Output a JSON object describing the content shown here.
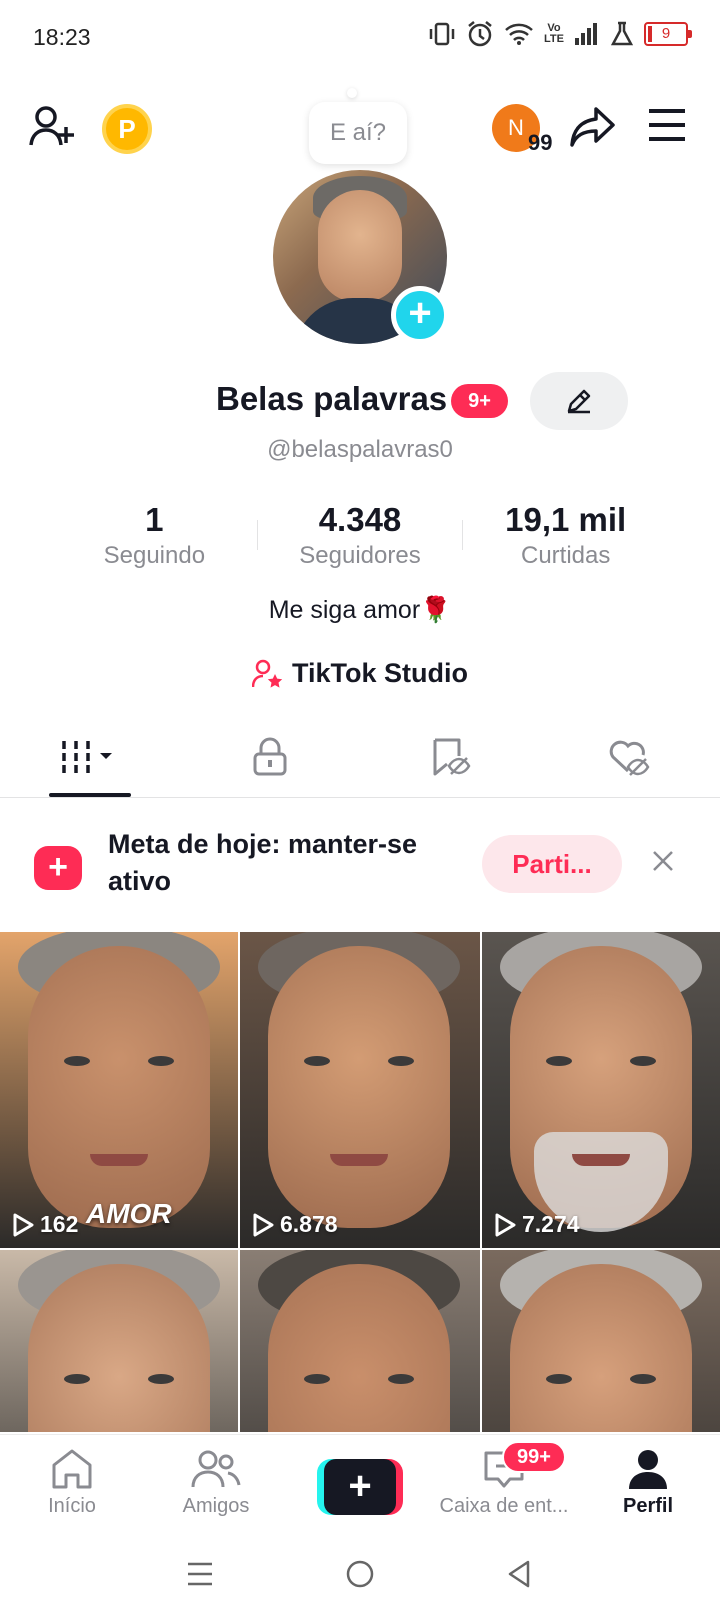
{
  "status_bar": {
    "time": "18:23",
    "lte": "Vo\nLTE",
    "battery": "9",
    "icons": [
      "vibrate-icon",
      "alarm-icon",
      "wifi-icon",
      "lte-icon",
      "signal-icon",
      "flask-icon",
      "battery-icon"
    ]
  },
  "header": {
    "coin_letter": "P",
    "bubble_text": "E aí?",
    "notif_avatar_letter": "N",
    "notif_count": "99"
  },
  "profile": {
    "name": "Belas palavras",
    "name_badge": "9+",
    "username": "@belaspalavras0",
    "bio": "Me siga amor🌹",
    "studio_label": "TikTok Studio"
  },
  "stats": [
    {
      "value": "1",
      "label": "Seguindo"
    },
    {
      "value": "4.348",
      "label": "Seguidores"
    },
    {
      "value": "19,1 mil",
      "label": "Curtidas"
    }
  ],
  "goal": {
    "text": "Meta de hoje: manter-se ativo",
    "button": "Parti..."
  },
  "videos": [
    {
      "views": "162",
      "overlay": "AMOR",
      "skin": "#c9916c",
      "hair": "#8b8680",
      "bg": "#e3a46b"
    },
    {
      "views": "6.878",
      "overlay": "",
      "skin": "#d39c74",
      "hair": "#6e6660",
      "bg": "#6b5647"
    },
    {
      "views": "7.274",
      "overlay": "",
      "skin": "#d6a17c",
      "hair": "#a8a5a2",
      "bg": "#5a5550"
    },
    {
      "views": "",
      "overlay": "",
      "skin": "#d9a886",
      "hair": "#9a9590",
      "bg": "#c9b9a8"
    },
    {
      "views": "",
      "overlay": "",
      "skin": "#c98f6b",
      "hair": "#4d4843",
      "bg": "#8a7e74"
    },
    {
      "views": "",
      "overlay": "",
      "skin": "#d6a07c",
      "hair": "#b5b2ae",
      "bg": "#7a6a5e"
    }
  ],
  "bottom_nav": {
    "home": "Início",
    "friends": "Amigos",
    "inbox": "Caixa de ent...",
    "inbox_badge": "99+",
    "profile": "Perfil"
  }
}
